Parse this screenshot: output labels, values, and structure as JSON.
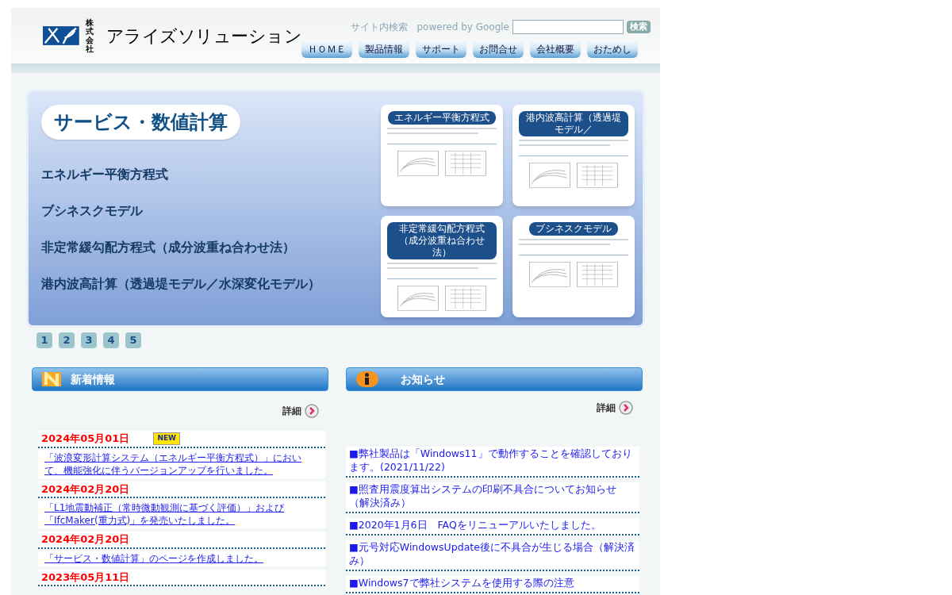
{
  "header": {
    "logo_text": "アライズソリューション",
    "logo_prefix_top": "株式",
    "logo_prefix_bottom": "会社",
    "search_label": "サイト内検索",
    "powered_by": "powered by Google",
    "search_button": "検索"
  },
  "nav": [
    {
      "label": "ＨＯＭＥ"
    },
    {
      "label": "製品情報"
    },
    {
      "label": "サポート"
    },
    {
      "label": "お問合せ"
    },
    {
      "label": "会社概要"
    },
    {
      "label": "おためし"
    }
  ],
  "banner": {
    "title": "サービス・数値計算",
    "items": [
      "エネルギー平衡方程式",
      "ブシネスクモデル",
      "非定常緩勾配方程式（成分波重ね合わせ法）",
      "港内波高計算（透過堤モデル／水深変化モデル）"
    ],
    "cards": [
      {
        "label": "エネルギー平衡方程式"
      },
      {
        "label": "港内波高計算（透過堤モデル／"
      },
      {
        "label": "非定常緩勾配方程式（成分波重ね合わせ法）"
      },
      {
        "label": "ブシネスクモデル"
      }
    ]
  },
  "pager": [
    {
      "label": "1"
    },
    {
      "label": "2"
    },
    {
      "label": "3"
    },
    {
      "label": "4"
    },
    {
      "label": "5"
    }
  ],
  "news": {
    "title": "新着情報",
    "more": "詳細",
    "items": [
      {
        "date": "2024年05月01日",
        "new": true,
        "badge": "NEW",
        "text": "「波浪変形計算システム（エネルギー平衡方程式）」において、機能強化に伴うバージョンアップを行いました。"
      },
      {
        "date": "2024年02月20日",
        "new": false,
        "text": "「L1地震動補正（常時微動観測に基づく評価）」および「IfcMaker(重力式)」を発売いたしました。"
      },
      {
        "date": "2024年02月20日",
        "new": false,
        "text": "「サービス・数値計算」のページを作成しました。"
      },
      {
        "date": "2023年05月11日",
        "new": false
      }
    ]
  },
  "notices": {
    "title": "お知らせ",
    "more": "詳細",
    "items": [
      "■弊社製品は「Windows11」で動作することを確認しております。(2021/11/22)",
      "■照査用震度算出システムの印刷不具合についてお知らせ（解決済み）",
      "■2020年1月6日　FAQをリニューアルいたしました。",
      "■元号対応WindowsUpdate後に不具合が生じる場合（解決済み）",
      "■Windows7で弊社システムを使用する際の注意"
    ]
  }
}
